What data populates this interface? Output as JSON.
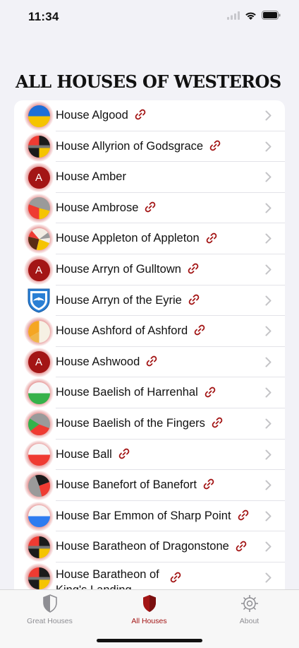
{
  "status": {
    "time": "11:34"
  },
  "page": {
    "title": "ALL HOUSES OF WESTEROS"
  },
  "colors": {
    "accent": "#a31515",
    "sigil_glow": "#c81e1e",
    "link": "#a31515"
  },
  "houses": [
    {
      "name": "House Algood",
      "has_link": true,
      "sigil": "blue-yellow-halves"
    },
    {
      "name": "House Allyrion of Godsgrace",
      "has_link": true,
      "sigil": "black-yellow-red-quarters"
    },
    {
      "name": "House Amber",
      "has_link": false,
      "sigil": "letter-a",
      "sigil_letter": "A"
    },
    {
      "name": "House Ambrose",
      "has_link": true,
      "sigil": "grey-red-yellow-thirds"
    },
    {
      "name": "House Appleton of Appleton",
      "has_link": true,
      "sigil": "white-red-yellow-brown-segments"
    },
    {
      "name": "House Arryn of Gulltown",
      "has_link": true,
      "sigil": "letter-a",
      "sigil_letter": "A"
    },
    {
      "name": "House Arryn of the Eyrie",
      "has_link": true,
      "sigil": "blue-falcon-shield"
    },
    {
      "name": "House Ashford of Ashford",
      "has_link": true,
      "sigil": "white-orange-halves"
    },
    {
      "name": "House Ashwood",
      "has_link": true,
      "sigil": "letter-a",
      "sigil_letter": "A"
    },
    {
      "name": "House Baelish of Harrenhal",
      "has_link": true,
      "sigil": "white-green-halves"
    },
    {
      "name": "House Baelish of the Fingers",
      "has_link": true,
      "sigil": "grey-green-red-thirds"
    },
    {
      "name": "House Ball",
      "has_link": true,
      "sigil": "white-red-halves"
    },
    {
      "name": "House Banefort of Banefort",
      "has_link": true,
      "sigil": "black-grey-red-segments"
    },
    {
      "name": "House Bar Emmon of Sharp Point",
      "has_link": true,
      "sigil": "white-blue-halves"
    },
    {
      "name": "House Baratheon of Dragonstone",
      "has_link": true,
      "sigil": "black-yellow-red-quarters"
    },
    {
      "name": "House Baratheon of King's Landing",
      "label_line1": "House Baratheon of",
      "label_line2": "King's Landing",
      "has_link": true,
      "sigil": "black-yellow-red-quarters"
    }
  ],
  "tabs": [
    {
      "label": "Great Houses",
      "icon": "shield-icon",
      "active": false
    },
    {
      "label": "All Houses",
      "icon": "shield-icon",
      "active": true
    },
    {
      "label": "About",
      "icon": "gear-icon",
      "active": false
    }
  ]
}
